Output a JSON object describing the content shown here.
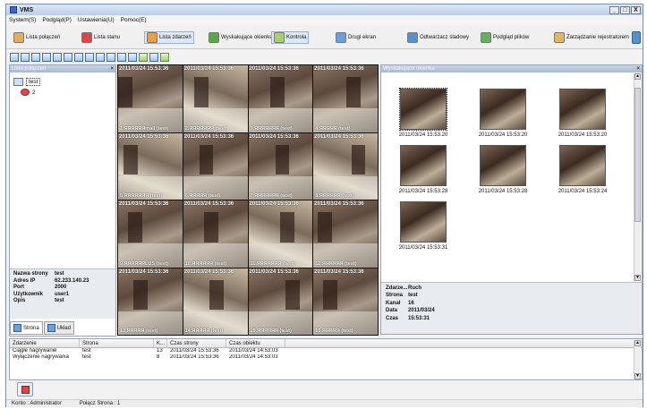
{
  "window": {
    "title": "VMS",
    "buttons": [
      "_",
      "□",
      "X"
    ]
  },
  "menu": [
    "System(S)",
    "Podgląd(P)",
    "Ustawienia(U)",
    "Pomoc(E)"
  ],
  "toolbar": {
    "buttons": [
      {
        "label": "Lista połączeń",
        "icon": "connection-list-icon",
        "color": "#e0b060"
      },
      {
        "label": "Lista stanu",
        "icon": "status-list-icon",
        "color": "#d84848"
      },
      {
        "label": "Lista zdarzeń",
        "icon": "event-list-icon",
        "color": "#e8a040"
      },
      {
        "label": "Wyskakujące okienka",
        "icon": "popup-icon",
        "color": "#58a848"
      },
      {
        "label": "Kontrola",
        "icon": "control-icon",
        "color": "#a8d070"
      },
      {
        "label": "Drugi ekran",
        "icon": "second-screen-icon",
        "color": "#6a9ee0"
      },
      {
        "label": "Odtwarzacz śladowy",
        "icon": "player-icon",
        "color": "#5a8fd0"
      },
      {
        "label": "Podgląd plików",
        "icon": "file-preview-icon",
        "color": "#60b060"
      },
      {
        "label": "Zarządzanie rejestratorem",
        "icon": "recorder-manage-icon",
        "color": "#e0b860"
      }
    ]
  },
  "left": {
    "title": "Lista połączeń",
    "tree": [
      {
        "label": "test",
        "icon": "computer-icon"
      },
      {
        "label": "2",
        "icon": "camera-icon"
      }
    ],
    "props": [
      {
        "k": "Nazwa strony",
        "v": "test"
      },
      {
        "k": "Adres IP",
        "v": "62.233.140.23"
      },
      {
        "k": "Port",
        "v": "2000"
      },
      {
        "k": "Użytkownik",
        "v": "user1"
      },
      {
        "k": "Opis",
        "v": "test"
      }
    ],
    "tabs": [
      "Strona",
      "Układ"
    ]
  },
  "grid": {
    "cells": [
      {
        "ts": "2011/03/24 15:53:36",
        "label": "1.ЯЯЯЯЯЯmall (test)"
      },
      {
        "ts": "2011/03/24 15:53:36",
        "label": "2.ЯЯЯЯЯЯЯ (test)"
      },
      {
        "ts": "2011/03/24 15:53:36",
        "label": "3.ЯЯЯЯЯЯЯ (test)"
      },
      {
        "ts": "2011/03/24 15:53:36",
        "label": "4.ЯЯЯЯЯ (test)"
      },
      {
        "ts": "2011/03/24 15:53:36",
        "label": "5.ЯЯЯЯЯЯЯ (test)"
      },
      {
        "ts": "2011/03/24 15:53:36",
        "label": "6.ЯЯЯЯЯ (test)"
      },
      {
        "ts": "2011/03/24 15:53:36",
        "label": "7.ЯЯЯЯЯЯЯ (test)"
      },
      {
        "ts": "2011/03/24 15:53:36",
        "label": "8.ЯЯЯЯЯЯ (test)"
      },
      {
        "ts": "2011/03/24 15:53:36",
        "label": "9.ЯЯЯЯЯPLUS (test)"
      },
      {
        "ts": "2011/03/24 15:53:36",
        "label": "10.ЯЯЯЯЯЯ (test)"
      },
      {
        "ts": "2011/03/24 15:53:36",
        "label": "11.ЯЯЯЯЯЯЯ (test)"
      },
      {
        "ts": "2011/03/24 15:53:36",
        "label": "12.ЯЯЯЯЯЯ (test)"
      },
      {
        "ts": "2011/03/24 15:53:36",
        "label": "13.ЯЯЯЯЯ (test)"
      },
      {
        "ts": "2011/03/24 15:53:36",
        "label": "14.ЯЯЯЯЯ (test)"
      },
      {
        "ts": "2011/03/24 15:53:36",
        "label": "15.ЯЯЯЯЯЯ (test)"
      },
      {
        "ts": "2011/03/24 15:53:36",
        "label": "16.ЯЯЯЯЯ (test)"
      }
    ]
  },
  "popups": {
    "title": "Wyskakujące okienka",
    "thumbs": [
      {
        "cap": "2011/03/24 15:53:20"
      },
      {
        "cap": "2011/03/24 15:53:20"
      },
      {
        "cap": "2011/03/24 15:53:20"
      },
      {
        "cap": "2011/03/24 15:53:28"
      },
      {
        "cap": "2011/03/24 15:53:28"
      },
      {
        "cap": "2011/03/24 15:53:24"
      },
      {
        "cap": "2011/03/24 15:53:31"
      }
    ],
    "event": [
      {
        "k": "Zdarze...",
        "v": "Ruch"
      },
      {
        "k": "Strona",
        "v": "test"
      },
      {
        "k": "Kanał",
        "v": "16"
      },
      {
        "k": "Data",
        "v": "2011/03/24"
      },
      {
        "k": "Czas",
        "v": "15:53:31"
      }
    ]
  },
  "events": {
    "headers": [
      "Zdarzenie",
      "Strona",
      "K...",
      "Czas strony",
      "Czas obiektu"
    ],
    "rows": [
      [
        "Ciągłe nagrywanie",
        "test",
        "13",
        "2011/03/24 15:53:36",
        "2011/03/24 14:53:03"
      ],
      [
        "Wyłączenie nagrywania",
        "test",
        "8",
        "2011/03/24 15:53:36",
        "2011/03/24 14:53:03"
      ]
    ]
  },
  "status": {
    "user": "Konto : Administrator",
    "connected": "Połącz Strona : 1"
  }
}
